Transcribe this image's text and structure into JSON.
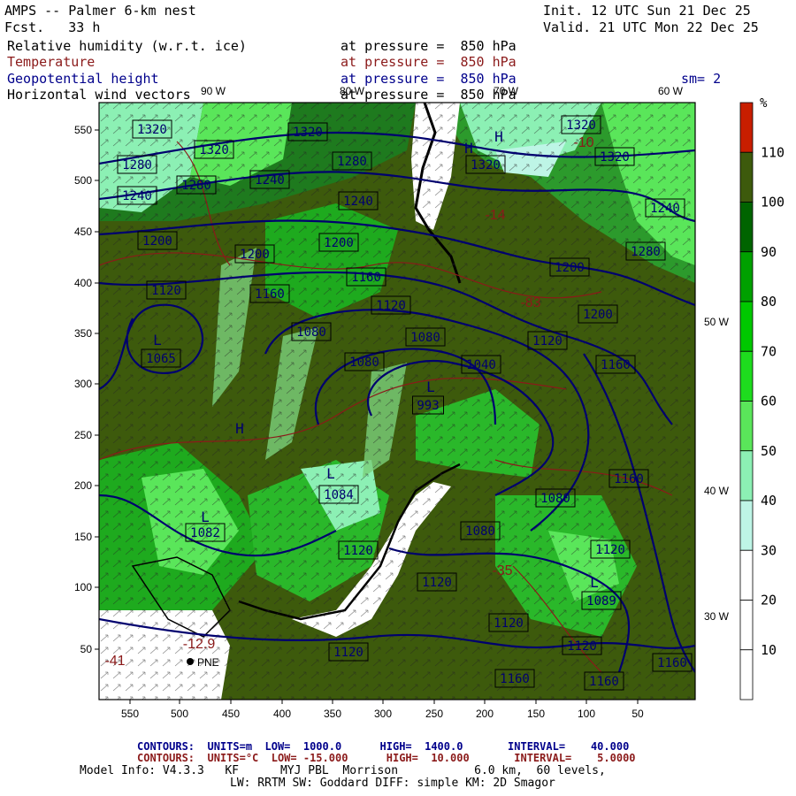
{
  "header": {
    "title": "AMPS -- Palmer 6-km nest",
    "fcst": "Fcst.   33 h",
    "init": "Init. 12 UTC Sun 21 Dec 25",
    "valid": "Valid. 21 UTC Mon 22 Dec 25",
    "fields": [
      {
        "name": "Relative humidity (w.r.t. ice)",
        "level": "at pressure =  850 hPa",
        "color": "black"
      },
      {
        "name": "Temperature",
        "level": "at pressure =  850 hPa",
        "color": "red"
      },
      {
        "name": "Geopotential height",
        "level": "at pressure =  850 hPa",
        "color": "blue",
        "extra": "sm= 2"
      },
      {
        "name": "Horizontal wind vectors",
        "level": "at pressure =  850 hPa",
        "color": "black"
      }
    ]
  },
  "map": {
    "x_ticks": [
      "550",
      "500",
      "450",
      "400",
      "350",
      "300",
      "250",
      "200",
      "150",
      "100",
      "50"
    ],
    "y_ticks": [
      "550",
      "500",
      "450",
      "400",
      "350",
      "300",
      "250",
      "200",
      "150",
      "100",
      "50"
    ],
    "lon_labels_top": [
      "90 W",
      "80 W",
      "70 W",
      "60 W"
    ],
    "lon_labels_right": [
      "50 W",
      "40 W",
      "30 W"
    ],
    "station": "PNE",
    "height_labels": [
      "1320",
      "1320",
      "1320",
      "1280",
      "1280",
      "1280",
      "1240",
      "1240",
      "1240",
      "1200",
      "1200",
      "1200",
      "1160",
      "1160",
      "1120",
      "1120",
      "1080",
      "1080",
      "1040",
      "1080",
      "1065",
      "993",
      "1084",
      "1082",
      "1120",
      "1120",
      "1080",
      "1080",
      "1120",
      "1089",
      "1120",
      "1120",
      "1120",
      "1160",
      "1160",
      "1160",
      "1200",
      "1200",
      "1280",
      "1240",
      "1320",
      "1320",
      "1320",
      "1120",
      "1160",
      "1160"
    ],
    "temp_labels": [
      "-12.9",
      "-41",
      "-83",
      "-35",
      "-14",
      "-10"
    ],
    "pressure_centers": [
      "L",
      "L",
      "L",
      "L",
      "L",
      "H",
      "H",
      "H"
    ]
  },
  "colorbar": {
    "unit": "%",
    "labels": [
      "110",
      "100",
      "90",
      "80",
      "70",
      "60",
      "50",
      "40",
      "30",
      "20",
      "10"
    ],
    "colors": [
      "#c81e00",
      "#3d5a0c",
      "#006400",
      "#00a000",
      "#00c800",
      "#1edc1e",
      "#5ae65a",
      "#8cf0b4",
      "#bef5e6",
      "#ffffff",
      "#ffffff",
      "#ffffff"
    ]
  },
  "footer": {
    "contours_height": "CONTOURS:  UNITS=m  LOW=  1000.0      HIGH=  1400.0       INTERVAL=    40.000",
    "contours_temp": "CONTOURS:  UNITS=°C  LOW= -15.000      HIGH=  10.000       INTERVAL=    5.0000",
    "model_info": "Model Info: V4.3.3   KF      MYJ PBL  Morrison           6.0 km,  60 levels,",
    "physics": "LW: RRTM SW: Goddard DIFF: simple KM: 2D Smagor"
  }
}
